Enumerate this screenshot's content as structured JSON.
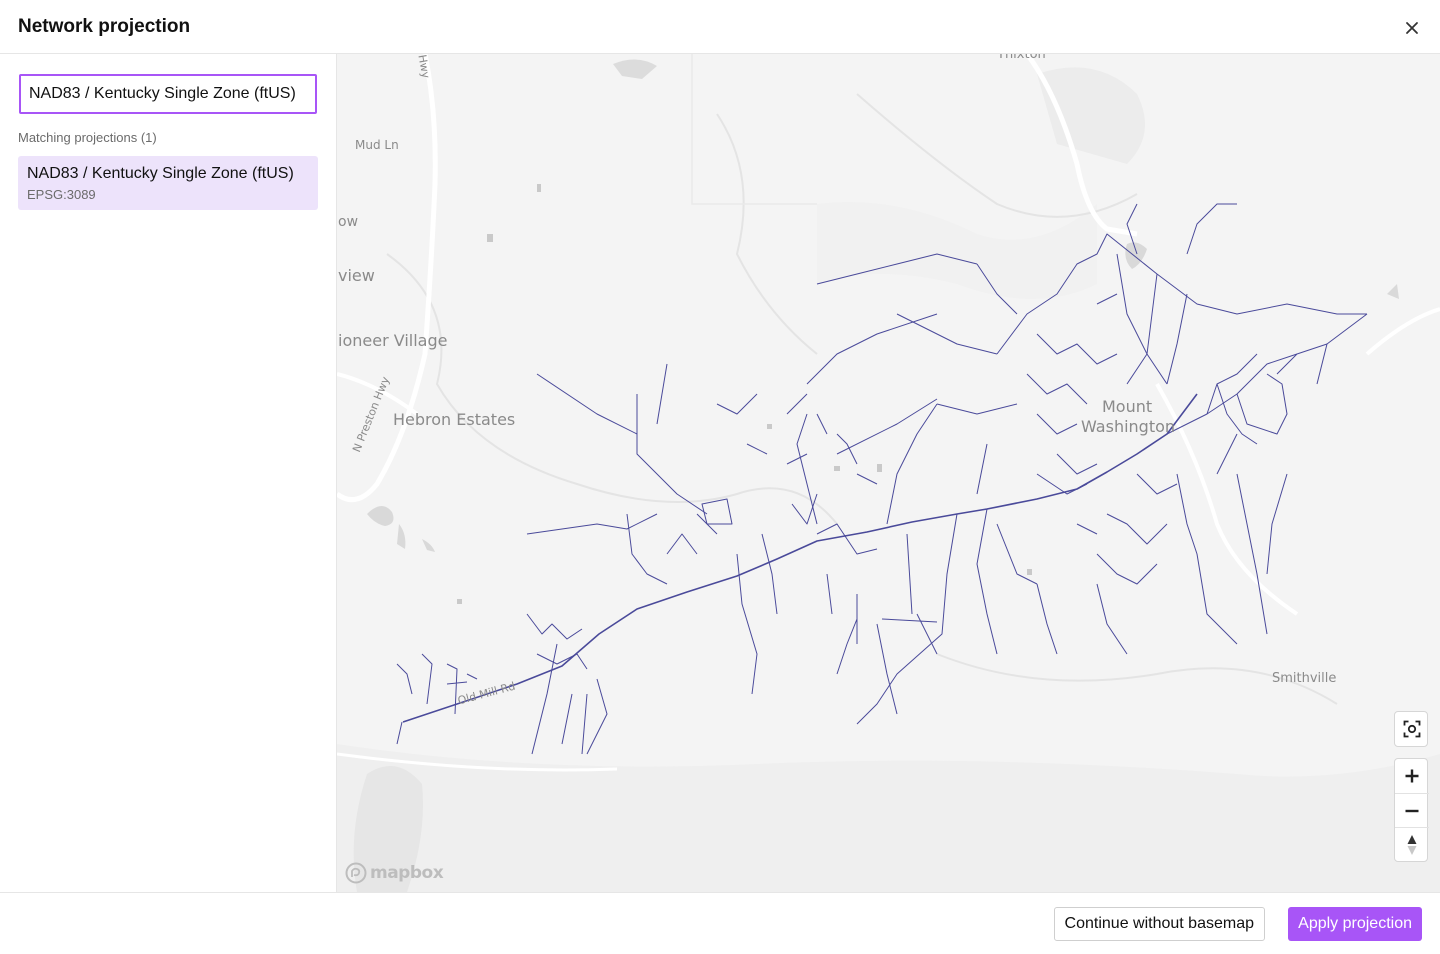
{
  "dialog": {
    "title": "Network projection",
    "close_icon": "close-icon"
  },
  "sidebar": {
    "search_value": "NAD83 / Kentucky Single Zone (ftUS)",
    "matching_label": "Matching projections (1)",
    "results": [
      {
        "name": "NAD83 / Kentucky Single Zone (ftUS)",
        "code": "EPSG:3089"
      }
    ]
  },
  "map": {
    "labels": {
      "thixton": "Thixton",
      "hwy_top": "Hwy",
      "mud_ln": "Mud Ln",
      "low": "ow",
      "view": "view",
      "pioneer_village": "ioneer Village",
      "n_preston_hwy": "N Preston Hwy",
      "hebron_estates": "Hebron Estates",
      "mount": "Mount",
      "washington": "Washington",
      "old_mill_rd": "Old Mill Rd",
      "smithville": "Smithville"
    },
    "attribution": "mapbox",
    "controls": {
      "locate_icon": "locate-focus-icon",
      "zoom_in_icon": "plus-icon",
      "zoom_out_icon": "minus-icon",
      "compass_icon": "compass-icon"
    },
    "colors": {
      "background": "#f4f4f4",
      "road": "#ffffff",
      "water": "#d9d9d9",
      "network": "#4a4a9a"
    }
  },
  "footer": {
    "secondary_label": "Continue without basemap",
    "primary_label": "Apply projection"
  },
  "colors": {
    "accent": "#a855f7",
    "selected_bg": "#ede3fb"
  }
}
